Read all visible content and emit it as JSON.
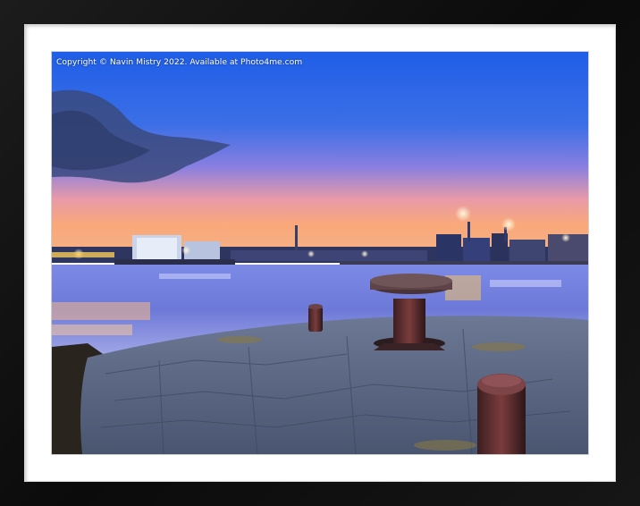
{
  "watermark": {
    "text": "Copyright © Navin Mistry 2022. Available at Photo4me.com"
  },
  "colors": {
    "frame": "#111111",
    "mount": "#ffffff",
    "sky_top": "#1f5ee8",
    "sky_horizon": "#f9a87a",
    "water": "#6d79d8",
    "stone": "#5f6b86"
  },
  "scene": {
    "subject": "harbour at dusk with stone pier and bollards"
  }
}
